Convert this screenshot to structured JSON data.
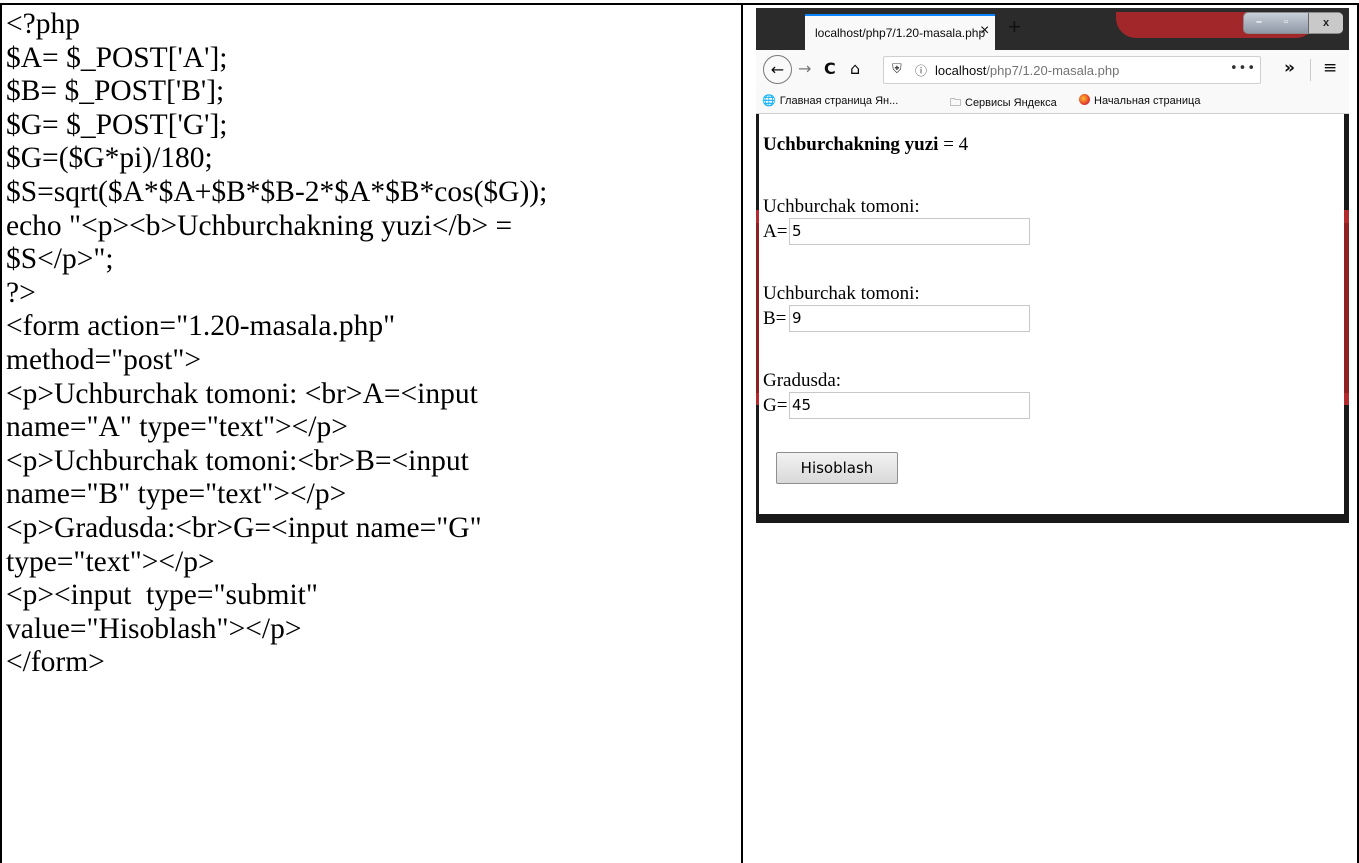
{
  "code": {
    "lines": [
      "<?php",
      "$A= $_POST['A'];",
      "$B= $_POST['B'];",
      "$G= $_POST['G'];",
      "$G=($G*pi)/180;",
      "$S=sqrt($A*$A+$B*$B-2*$A*$B*cos($G));",
      "echo \"<p><b>Uchburchakning yuzi</b> =",
      "$S</p>\";",
      "?>",
      "<form action=\"1.20-masala.php\"",
      "method=\"post\">",
      "<p>Uchburchak tomoni: <br>A=<input",
      "name=\"A\" type=\"text\"></p>",
      "<p>Uchburchak tomoni:<br>B=<input",
      "name=\"B\" type=\"text\"></p>",
      "<p>Gradusda:<br>G=<input name=\"G\"",
      "type=\"text\"></p>",
      "<p><input  type=\"submit\"",
      "value=\"Hisoblash\"></p>",
      "</form>"
    ]
  },
  "browser": {
    "tab_title": "localhost/php7/1.20-masala.php",
    "tab_close": "×",
    "new_tab": "+",
    "window_buttons": {
      "minimize": "–",
      "maximize": "▫",
      "close": "x"
    },
    "nav": {
      "back": "←",
      "forward": "→",
      "reload": "C",
      "home": "⌂",
      "url_host": "localhost",
      "url_path": "/php7/1.20-masala.php",
      "url_more": "•••",
      "overflow": "»",
      "menu": "≡"
    },
    "bookmarks": [
      {
        "icon": "globe-icon",
        "label": "Главная страница Ян..."
      },
      {
        "icon": "folder-icon",
        "label": "Сервисы Яндекса"
      },
      {
        "icon": "firefox-icon",
        "label": "Начальная страница"
      }
    ],
    "page": {
      "result_bold": "Uchburchakning yuzi",
      "result_rest": " = 4",
      "fields": [
        {
          "label": "Uchburchak tomoni:",
          "prefix": "A=",
          "value": "5"
        },
        {
          "label": "Uchburchak tomoni:",
          "prefix": "B=",
          "value": "9"
        },
        {
          "label": "Gradusda:",
          "prefix": "G=",
          "value": "45"
        }
      ],
      "submit_label": "Hisoblash"
    }
  }
}
